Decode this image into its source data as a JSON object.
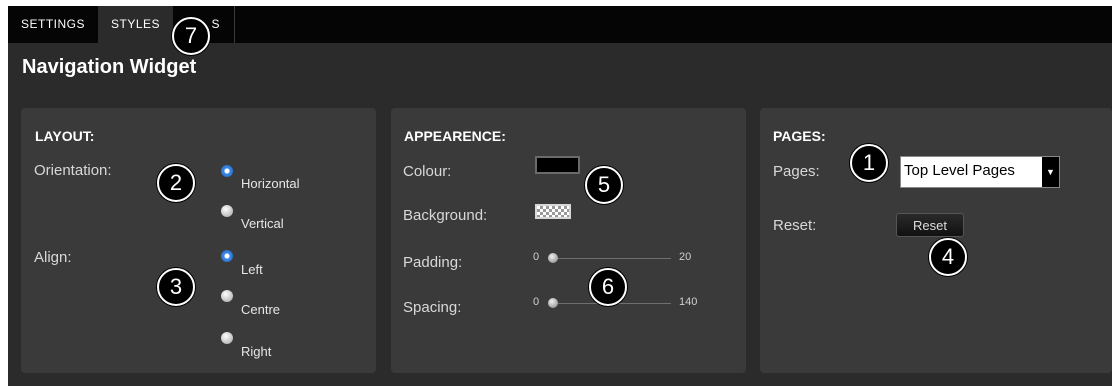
{
  "tabs": [
    {
      "label": "SETTINGS"
    },
    {
      "label": "STYLES"
    },
    {
      "label": "S"
    }
  ],
  "title": "Navigation Widget",
  "layout": {
    "heading": "LAYOUT:",
    "orientation_label": "Orientation:",
    "orientation_options": [
      "Horizontal",
      "Vertical"
    ],
    "align_label": "Align:",
    "align_options": [
      "Left",
      "Centre",
      "Right"
    ]
  },
  "appearance": {
    "heading": "APPEARENCE:",
    "colour_label": "Colour:",
    "colour_value": "#000000",
    "background_label": "Background:",
    "padding_label": "Padding:",
    "padding_min": "0",
    "padding_max": "20",
    "padding_value": 0,
    "spacing_label": "Spacing:",
    "spacing_min": "0",
    "spacing_max": "140",
    "spacing_value": 0
  },
  "pages": {
    "heading": "PAGES:",
    "pages_label": "Pages:",
    "pages_value": "Top Level Pages",
    "reset_label": "Reset:",
    "reset_button": "Reset"
  },
  "callouts": [
    "1",
    "2",
    "3",
    "4",
    "5",
    "6",
    "7"
  ],
  "colors": {
    "accent_radio": "#2e7be0",
    "panel": "#3a3a3a",
    "background": "#2b2b2b"
  }
}
